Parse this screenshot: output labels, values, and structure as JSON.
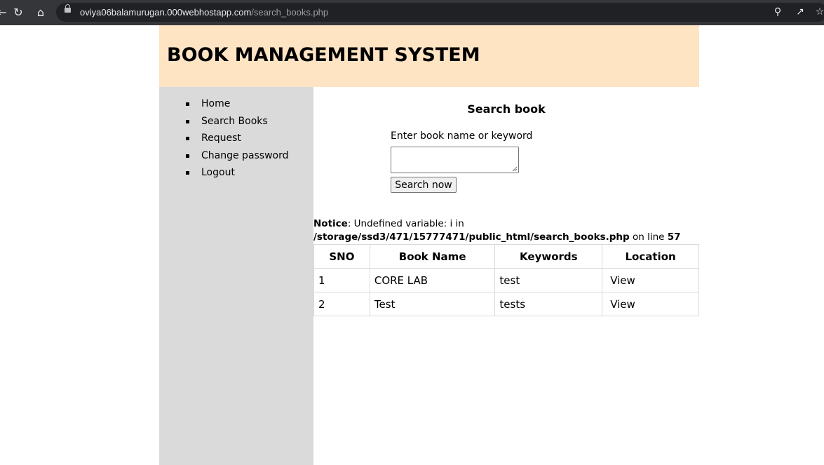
{
  "browser": {
    "url_host": "oviya06balamurugan.000webhostapp.com",
    "url_path": "/search_books.php"
  },
  "header": {
    "title": "BOOK MANAGEMENT SYSTEM"
  },
  "sidebar": {
    "items": [
      {
        "label": "Home"
      },
      {
        "label": "Search Books"
      },
      {
        "label": "Request"
      },
      {
        "label": "Change password"
      },
      {
        "label": "Logout"
      }
    ]
  },
  "search": {
    "title": "Search book",
    "label": "Enter book name or keyword",
    "value": "",
    "button_label": "Search now"
  },
  "notice": {
    "prefix": "Notice",
    "message": ": Undefined variable: i in",
    "path": "/storage/ssd3/471/15777471/public_html/search_books.php",
    "on_line": " on line ",
    "line": "57"
  },
  "table": {
    "headers": [
      "SNO",
      "Book Name",
      "Keywords",
      "Location"
    ],
    "rows": [
      [
        "1",
        "CORE LAB",
        "test",
        "View"
      ],
      [
        "2",
        "Test",
        "tests",
        "View"
      ]
    ]
  }
}
